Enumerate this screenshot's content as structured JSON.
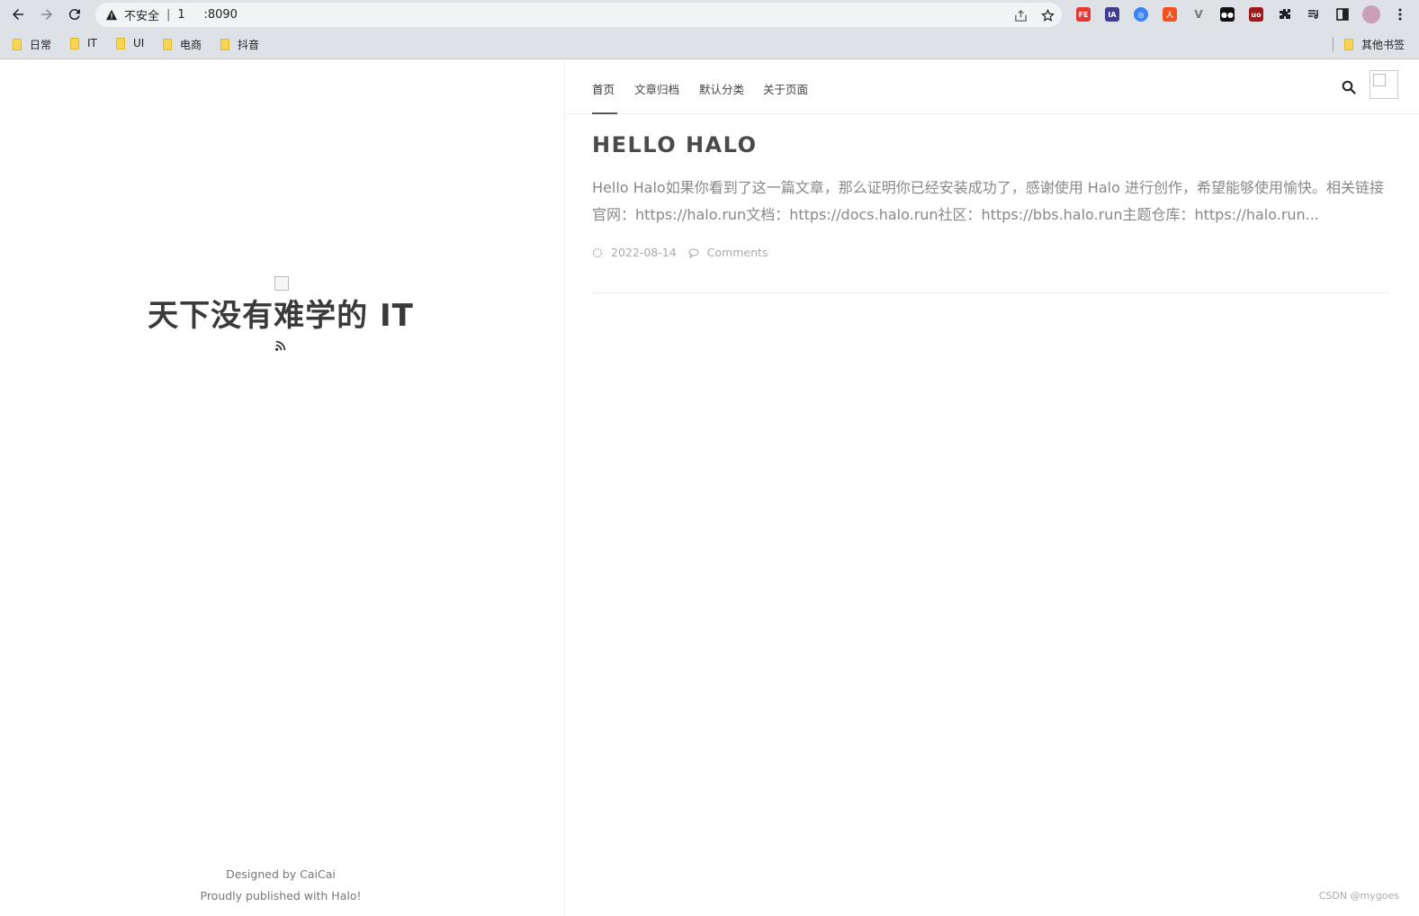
{
  "browser": {
    "address": {
      "security_label": "不安全",
      "url": "1        :8090"
    },
    "bookmarks": [
      {
        "label": "日常"
      },
      {
        "label": "IT"
      },
      {
        "label": "UI"
      },
      {
        "label": "电商"
      },
      {
        "label": "抖音"
      }
    ],
    "other_bookmarks": "其他书签"
  },
  "sidebar": {
    "site_title": "天下没有难学的 IT",
    "footer_line1_prefix": "Designed by ",
    "footer_line1_link": "CaiCai",
    "footer_line2_prefix": "Proudly published with ",
    "footer_line2_link": "Halo!"
  },
  "nav": {
    "items": [
      {
        "label": "首页"
      },
      {
        "label": "文章归档"
      },
      {
        "label": "默认分类"
      },
      {
        "label": "关于页面"
      }
    ]
  },
  "post": {
    "title": "HELLO HALO",
    "excerpt": "Hello Halo如果你看到了这一篇文章，那么证明你已经安装成功了，感谢使用 Halo 进行创作，希望能够使用愉快。相关链接官网：https://halo.run文档：https://docs.halo.run社区：https://bbs.halo.run主题仓库：https://halo.run...",
    "date": "2022-08-14",
    "comments": "Comments"
  },
  "watermark": "CSDN @mygoes"
}
